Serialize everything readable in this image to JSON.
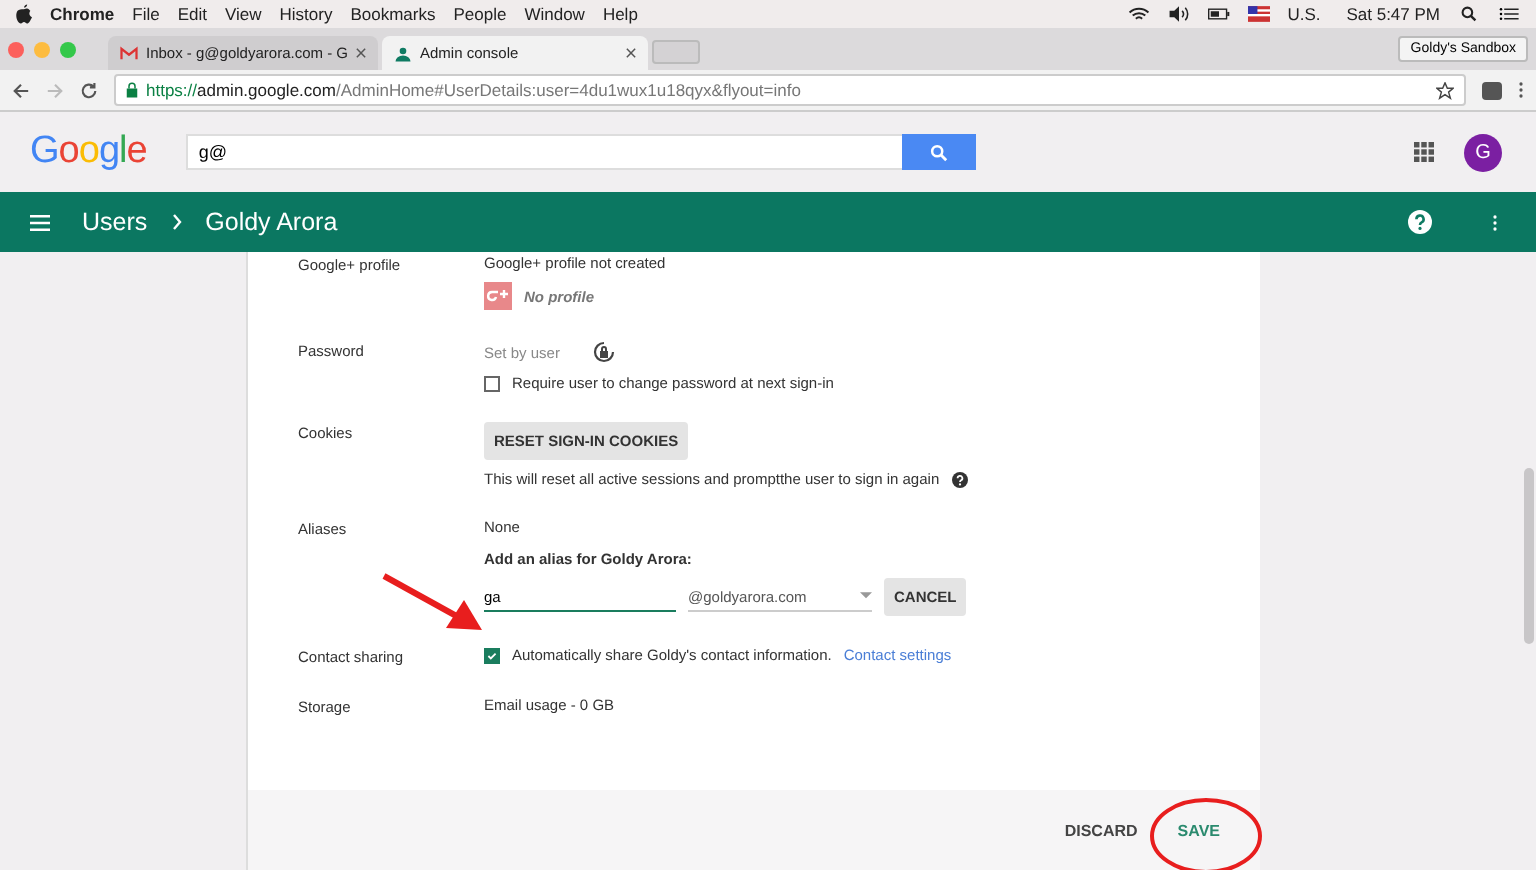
{
  "menu_bar": {
    "app": "Chrome",
    "items": [
      "File",
      "Edit",
      "View",
      "History",
      "Bookmarks",
      "People",
      "Window",
      "Help"
    ],
    "input_source": "U.S.",
    "clock": "Sat 5:47 PM"
  },
  "tabs": [
    {
      "title": "Inbox - g@goldyarora.com - G",
      "selected": false,
      "kind": "mail"
    },
    {
      "title": "Admin console",
      "selected": true,
      "kind": "admin"
    }
  ],
  "profile_button": "Goldy's Sandbox",
  "address_bar": {
    "scheme": "https://",
    "host": "admin.google.com",
    "path": "/AdminHome#UserDetails:user=4du1wux1u18qyx&flyout=info"
  },
  "header": {
    "logo": "Google",
    "search_value": "g@",
    "avatar": "G"
  },
  "breadcrumb": [
    "Users",
    "Goldy Arora"
  ],
  "sections": [
    {
      "kind": "profile",
      "label": "Google+ profile",
      "value": "Google+ profile not created",
      "note": "No profile"
    },
    {
      "kind": "password",
      "label": "Password",
      "value": "Set by user",
      "checkbox": {
        "label": "Require user to change password at next sign-in",
        "checked": false
      }
    },
    {
      "kind": "cookies",
      "label": "Cookies",
      "button": "RESET SIGN-IN COOKIES",
      "note": "This will reset all active sessions and promptthe user to sign in again"
    },
    {
      "kind": "aliases",
      "label": "Aliases",
      "value": "None",
      "prompt": "Add an alias for Goldy Arora:",
      "alias_value": "ga",
      "domain": "@goldyarora.com",
      "button": "CANCEL"
    },
    {
      "kind": "contact",
      "label": "Contact sharing",
      "checkbox": {
        "label": "Automatically share Goldy's contact information.",
        "checked": true
      },
      "link": "Contact settings"
    },
    {
      "kind": "storage",
      "label": "Storage",
      "value": "Email usage - 0 GB"
    }
  ],
  "footer_buttons": [
    {
      "label": "DISCARD",
      "kind": "discard"
    },
    {
      "label": "SAVE",
      "kind": "save"
    }
  ]
}
